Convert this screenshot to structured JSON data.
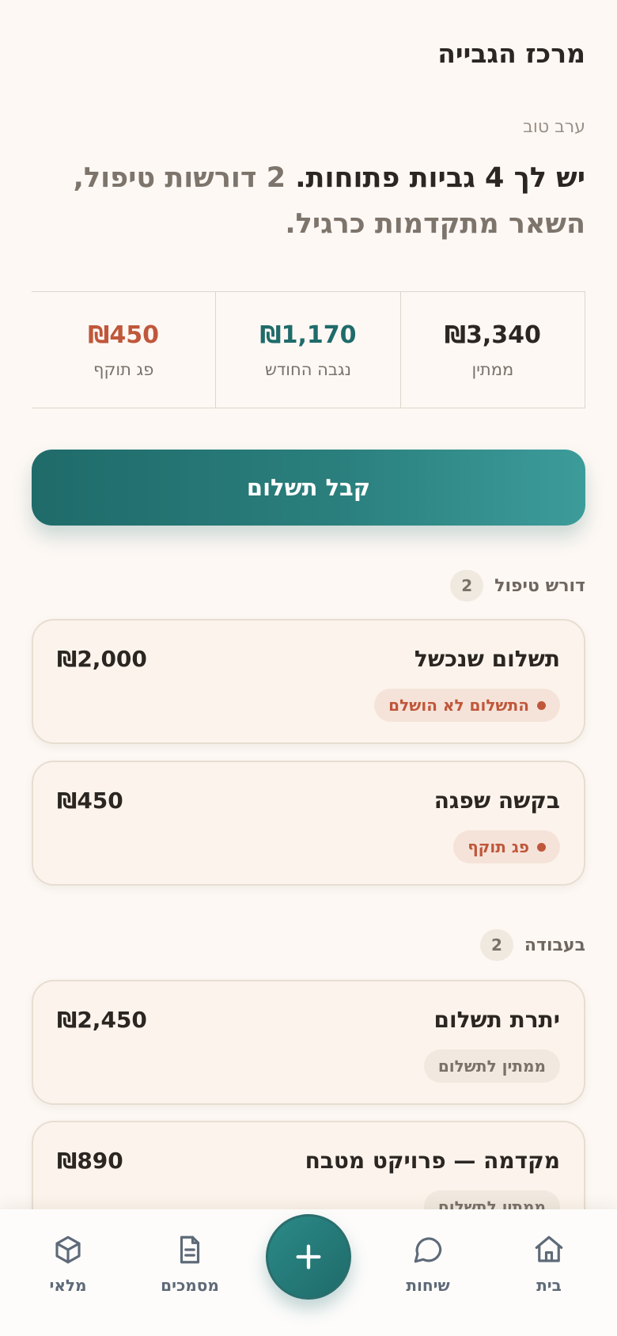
{
  "header": {
    "title": "מרכז הגבייה"
  },
  "greeting": "ערב טוב",
  "headline": {
    "strong": "יש לך 4 גביות פתוחות.",
    "rest": " 2 דורשות טיפול, השאר מתקדמות כרגיל."
  },
  "stats": [
    {
      "value": "₪3,340",
      "label": "ממתין",
      "color": "#2b2622"
    },
    {
      "value": "₪1,170",
      "label": "נגבה החודש",
      "color": "#1f6b6a"
    },
    {
      "value": "₪450",
      "label": "פג תוקף",
      "color": "#c0573b"
    }
  ],
  "cta": {
    "label": "קבל תשלום"
  },
  "sections": {
    "attention": {
      "title": "דורש טיפול",
      "count": "2"
    },
    "in_progress": {
      "title": "בעבודה",
      "count": "2"
    }
  },
  "cards": [
    {
      "title": "תשלום שנכשל",
      "amount": "₪2,000",
      "status": "התשלום לא הושלם"
    },
    {
      "title": "בקשה שפגה",
      "amount": "₪450",
      "status": "פג תוקף"
    },
    {
      "title": "יתרת תשלום",
      "amount": "₪2,450",
      "status": "ממתין לתשלום"
    },
    {
      "title": "מקדמה — פרויקט מטבח",
      "amount": "₪890",
      "status": "ממתין לתשלום"
    }
  ],
  "nav": {
    "home": "בית",
    "chats": "שיחות",
    "documents": "מסמכים",
    "inventory": "מלאי"
  },
  "colors": {
    "accent": "#1f6b6a",
    "danger": "#c0573b",
    "background": "#fdf8f4"
  }
}
